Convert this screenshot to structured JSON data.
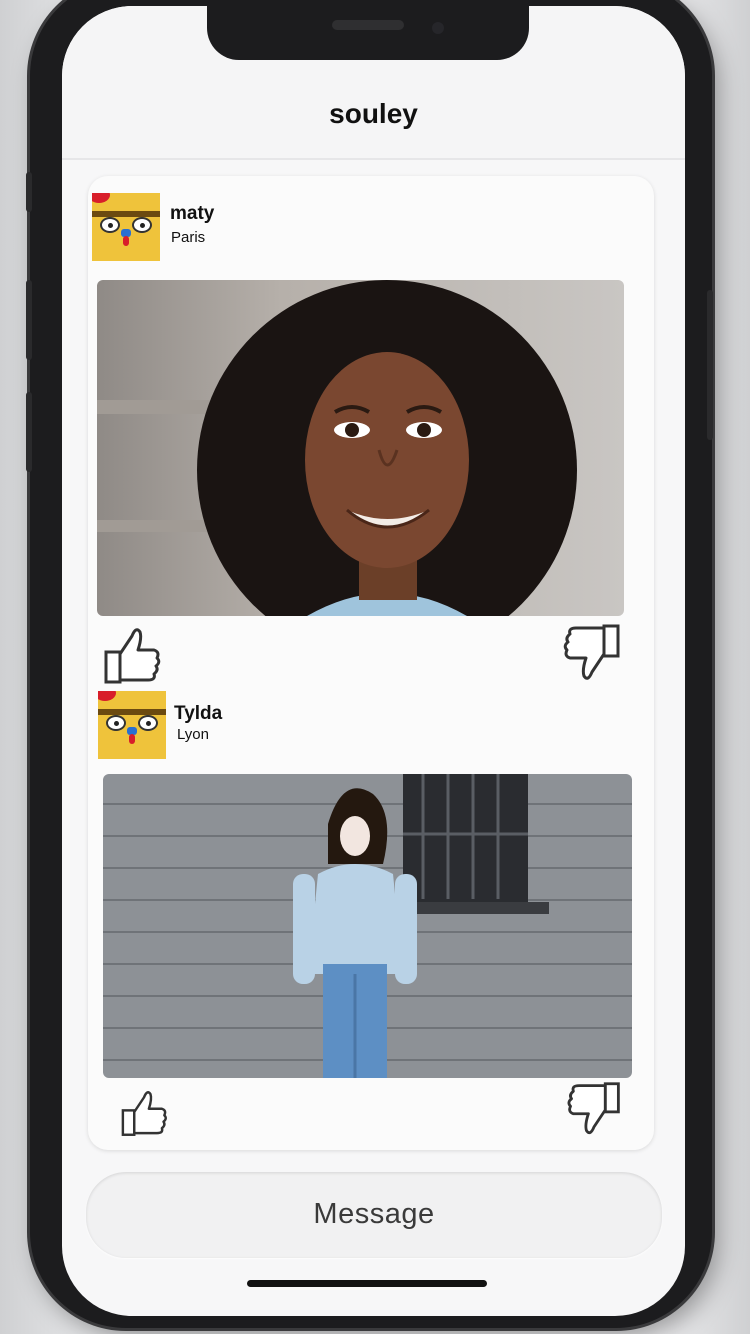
{
  "header": {
    "title": "souley"
  },
  "posts": [
    {
      "username": "maty",
      "city": "Paris"
    },
    {
      "username": "Tylda",
      "city": "Lyon"
    }
  ],
  "message_button": {
    "label": "Message"
  },
  "icons": {
    "like": "thumbs-up-icon",
    "dislike": "thumbs-down-icon"
  },
  "colors": {
    "avatar_bg": "#efc33b",
    "screen_bg": "#f7f7f8"
  }
}
